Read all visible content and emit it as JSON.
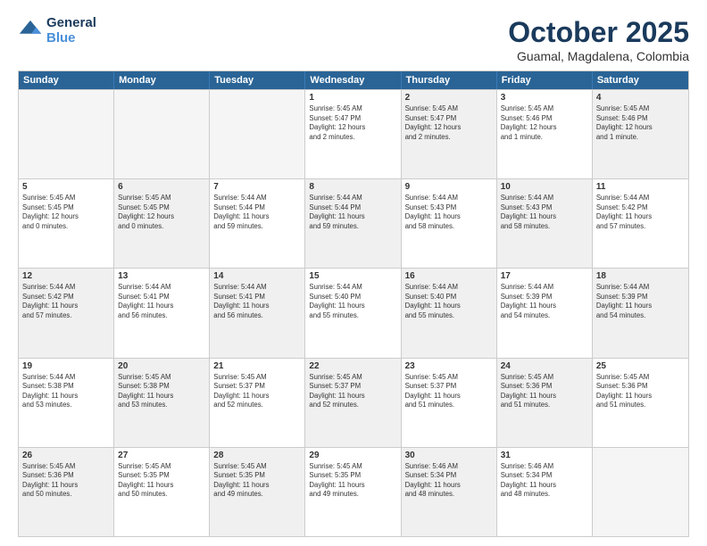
{
  "header": {
    "logo_general": "General",
    "logo_blue": "Blue",
    "main_title": "October 2025",
    "subtitle": "Guamal, Magdalena, Colombia"
  },
  "calendar": {
    "days_of_week": [
      "Sunday",
      "Monday",
      "Tuesday",
      "Wednesday",
      "Thursday",
      "Friday",
      "Saturday"
    ],
    "rows": [
      [
        {
          "day": "",
          "info": "",
          "empty": true
        },
        {
          "day": "",
          "info": "",
          "empty": true
        },
        {
          "day": "",
          "info": "",
          "empty": true
        },
        {
          "day": "1",
          "info": "Sunrise: 5:45 AM\nSunset: 5:47 PM\nDaylight: 12 hours\nand 2 minutes.",
          "shaded": false
        },
        {
          "day": "2",
          "info": "Sunrise: 5:45 AM\nSunset: 5:47 PM\nDaylight: 12 hours\nand 2 minutes.",
          "shaded": true
        },
        {
          "day": "3",
          "info": "Sunrise: 5:45 AM\nSunset: 5:46 PM\nDaylight: 12 hours\nand 1 minute.",
          "shaded": false
        },
        {
          "day": "4",
          "info": "Sunrise: 5:45 AM\nSunset: 5:46 PM\nDaylight: 12 hours\nand 1 minute.",
          "shaded": true
        }
      ],
      [
        {
          "day": "5",
          "info": "Sunrise: 5:45 AM\nSunset: 5:45 PM\nDaylight: 12 hours\nand 0 minutes.",
          "shaded": false
        },
        {
          "day": "6",
          "info": "Sunrise: 5:45 AM\nSunset: 5:45 PM\nDaylight: 12 hours\nand 0 minutes.",
          "shaded": true
        },
        {
          "day": "7",
          "info": "Sunrise: 5:44 AM\nSunset: 5:44 PM\nDaylight: 11 hours\nand 59 minutes.",
          "shaded": false
        },
        {
          "day": "8",
          "info": "Sunrise: 5:44 AM\nSunset: 5:44 PM\nDaylight: 11 hours\nand 59 minutes.",
          "shaded": true
        },
        {
          "day": "9",
          "info": "Sunrise: 5:44 AM\nSunset: 5:43 PM\nDaylight: 11 hours\nand 58 minutes.",
          "shaded": false
        },
        {
          "day": "10",
          "info": "Sunrise: 5:44 AM\nSunset: 5:43 PM\nDaylight: 11 hours\nand 58 minutes.",
          "shaded": true
        },
        {
          "day": "11",
          "info": "Sunrise: 5:44 AM\nSunset: 5:42 PM\nDaylight: 11 hours\nand 57 minutes.",
          "shaded": false
        }
      ],
      [
        {
          "day": "12",
          "info": "Sunrise: 5:44 AM\nSunset: 5:42 PM\nDaylight: 11 hours\nand 57 minutes.",
          "shaded": true
        },
        {
          "day": "13",
          "info": "Sunrise: 5:44 AM\nSunset: 5:41 PM\nDaylight: 11 hours\nand 56 minutes.",
          "shaded": false
        },
        {
          "day": "14",
          "info": "Sunrise: 5:44 AM\nSunset: 5:41 PM\nDaylight: 11 hours\nand 56 minutes.",
          "shaded": true
        },
        {
          "day": "15",
          "info": "Sunrise: 5:44 AM\nSunset: 5:40 PM\nDaylight: 11 hours\nand 55 minutes.",
          "shaded": false
        },
        {
          "day": "16",
          "info": "Sunrise: 5:44 AM\nSunset: 5:40 PM\nDaylight: 11 hours\nand 55 minutes.",
          "shaded": true
        },
        {
          "day": "17",
          "info": "Sunrise: 5:44 AM\nSunset: 5:39 PM\nDaylight: 11 hours\nand 54 minutes.",
          "shaded": false
        },
        {
          "day": "18",
          "info": "Sunrise: 5:44 AM\nSunset: 5:39 PM\nDaylight: 11 hours\nand 54 minutes.",
          "shaded": true
        }
      ],
      [
        {
          "day": "19",
          "info": "Sunrise: 5:44 AM\nSunset: 5:38 PM\nDaylight: 11 hours\nand 53 minutes.",
          "shaded": false
        },
        {
          "day": "20",
          "info": "Sunrise: 5:45 AM\nSunset: 5:38 PM\nDaylight: 11 hours\nand 53 minutes.",
          "shaded": true
        },
        {
          "day": "21",
          "info": "Sunrise: 5:45 AM\nSunset: 5:37 PM\nDaylight: 11 hours\nand 52 minutes.",
          "shaded": false
        },
        {
          "day": "22",
          "info": "Sunrise: 5:45 AM\nSunset: 5:37 PM\nDaylight: 11 hours\nand 52 minutes.",
          "shaded": true
        },
        {
          "day": "23",
          "info": "Sunrise: 5:45 AM\nSunset: 5:37 PM\nDaylight: 11 hours\nand 51 minutes.",
          "shaded": false
        },
        {
          "day": "24",
          "info": "Sunrise: 5:45 AM\nSunset: 5:36 PM\nDaylight: 11 hours\nand 51 minutes.",
          "shaded": true
        },
        {
          "day": "25",
          "info": "Sunrise: 5:45 AM\nSunset: 5:36 PM\nDaylight: 11 hours\nand 51 minutes.",
          "shaded": false
        }
      ],
      [
        {
          "day": "26",
          "info": "Sunrise: 5:45 AM\nSunset: 5:36 PM\nDaylight: 11 hours\nand 50 minutes.",
          "shaded": true
        },
        {
          "day": "27",
          "info": "Sunrise: 5:45 AM\nSunset: 5:35 PM\nDaylight: 11 hours\nand 50 minutes.",
          "shaded": false
        },
        {
          "day": "28",
          "info": "Sunrise: 5:45 AM\nSunset: 5:35 PM\nDaylight: 11 hours\nand 49 minutes.",
          "shaded": true
        },
        {
          "day": "29",
          "info": "Sunrise: 5:45 AM\nSunset: 5:35 PM\nDaylight: 11 hours\nand 49 minutes.",
          "shaded": false
        },
        {
          "day": "30",
          "info": "Sunrise: 5:46 AM\nSunset: 5:34 PM\nDaylight: 11 hours\nand 48 minutes.",
          "shaded": true
        },
        {
          "day": "31",
          "info": "Sunrise: 5:46 AM\nSunset: 5:34 PM\nDaylight: 11 hours\nand 48 minutes.",
          "shaded": false
        },
        {
          "day": "",
          "info": "",
          "empty": true
        }
      ]
    ]
  }
}
